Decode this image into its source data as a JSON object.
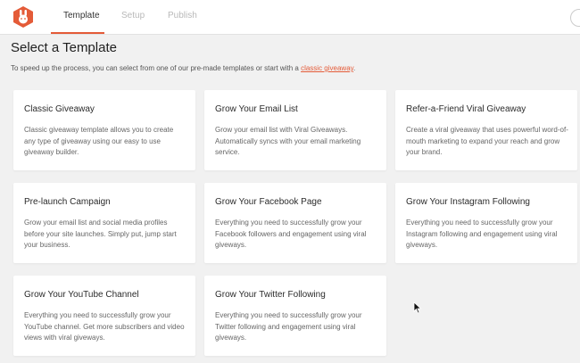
{
  "colors": {
    "accent": "#e45b38",
    "background": "#f1f1f1",
    "card": "#ffffff"
  },
  "header": {
    "logo_icon": "rabbit-logo-icon",
    "tabs": [
      {
        "label": "Template",
        "active": true
      },
      {
        "label": "Setup",
        "active": false
      },
      {
        "label": "Publish",
        "active": false
      }
    ],
    "right_icon": "circle-icon"
  },
  "main": {
    "title": "Select a Template",
    "intro_text": "To speed up the process, you can select from one of our pre-made templates or start with a ",
    "intro_link": "classic giveaway",
    "intro_end": ".",
    "templates": [
      {
        "title": "Classic Giveaway",
        "description": "Classic giveaway template allows you to create any type of giveaway using our easy to use giveaway builder."
      },
      {
        "title": "Grow Your Email List",
        "description": "Grow your email list with Viral Giveaways. Automatically syncs with your email marketing service."
      },
      {
        "title": "Refer-a-Friend Viral Giveaway",
        "description": "Create a viral giveaway that uses powerful word-of-mouth marketing to expand your reach and grow your brand."
      },
      {
        "title": "Pre-launch Campaign",
        "description": "Grow your email list and social media profiles before your site launches. Simply put, jump start your business."
      },
      {
        "title": "Grow Your Facebook Page",
        "description": "Everything you need to successfully grow your Facebook followers and engagement using viral giveways."
      },
      {
        "title": "Grow Your Instagram Following",
        "description": "Everything you need to successfully grow your Instagram following and engagement using viral giveways."
      },
      {
        "title": "Grow Your YouTube Channel",
        "description": "Everything you need to successfully grow your YouTube channel. Get more subscribers and video views with viral giveways."
      },
      {
        "title": "Grow Your Twitter Following",
        "description": "Everything you need to successfully grow your Twitter following and engagement using viral giveways."
      }
    ]
  }
}
